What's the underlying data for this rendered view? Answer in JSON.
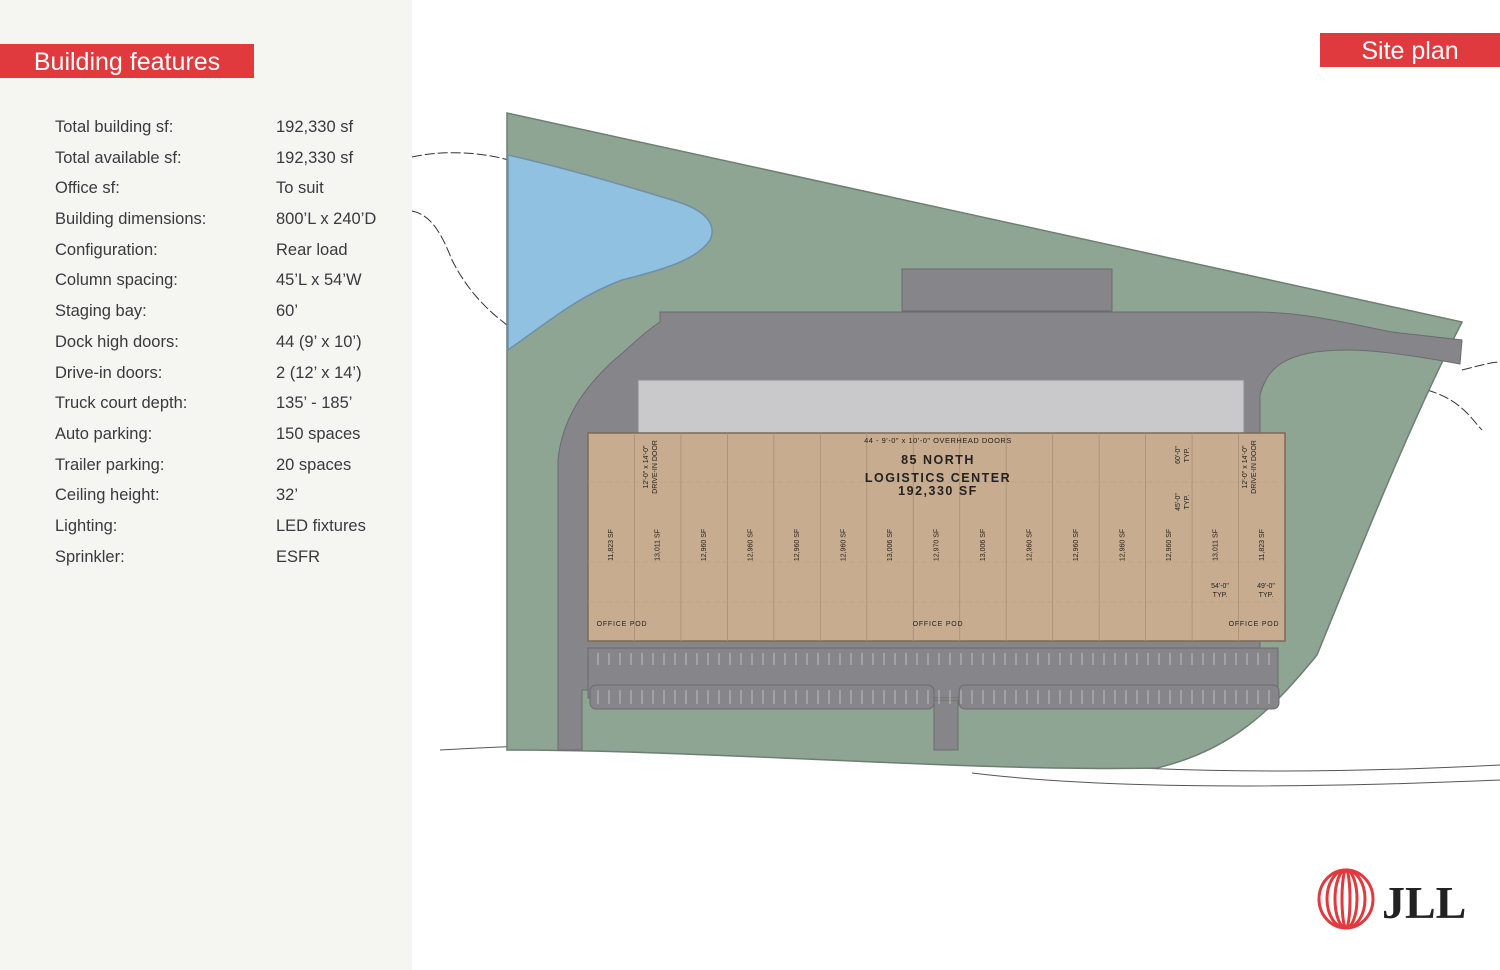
{
  "header": {
    "left_title": "Building features",
    "right_title": "Site plan"
  },
  "features": [
    {
      "label": "Total building sf:",
      "value": "192,330 sf"
    },
    {
      "label": "Total available sf:",
      "value": "192,330 sf"
    },
    {
      "label": "Office sf:",
      "value": "To suit"
    },
    {
      "label": "Building dimensions:",
      "value": "800’L x 240’D"
    },
    {
      "label": "Configuration:",
      "value": "Rear load"
    },
    {
      "label": "Column spacing:",
      "value": "45’L x 54’W"
    },
    {
      "label": "Staging bay:",
      "value": "60’"
    },
    {
      "label": "Dock  high doors:",
      "value": "44 (9’ x 10’)"
    },
    {
      "label": "Drive-in doors:",
      "value": "2 (12’ x 14’)"
    },
    {
      "label": "Truck court depth:",
      "value": "135’ - 185’"
    },
    {
      "label": "Auto parking:",
      "value": "150 spaces"
    },
    {
      "label": "Trailer parking:",
      "value": "20 spaces"
    },
    {
      "label": "Ceiling height:",
      "value": "32’"
    },
    {
      "label": "Lighting:",
      "value": "LED fixtures"
    },
    {
      "label": "Sprinkler:",
      "value": "ESFR"
    }
  ],
  "site_plan": {
    "building_name_line1": "85 NORTH",
    "building_name_line2": "LOGISTICS CENTER",
    "building_area": "192,330 SF",
    "overhead_doors_note": "44 - 9'-0\" x 10'-0\" OVERHEAD DOORS",
    "drive_in_size": "12'-0\" x 14'-0\"",
    "drive_in_label": "DRIVE-IN DOOR",
    "dim_60": "60'-0\"",
    "dim_45": "45'-0\"",
    "dim_54": "54'-0\"",
    "dim_49": "49'-0\"",
    "typ": "TYP.",
    "office_pod": "OFFICE POD",
    "bays": [
      "11,823 SF",
      "13,011 SF",
      "12,960 SF",
      "12,960 SF",
      "12,960 SF",
      "12,960 SF",
      "13,006 SF",
      "12,970 SF",
      "13,006 SF",
      "12,960 SF",
      "12,960 SF",
      "12,960 SF",
      "12,960 SF",
      "13,011 SF",
      "11,823 SF"
    ]
  },
  "logo": {
    "text": "JLL",
    "icon": "jll-logo-icon",
    "color": "#e03a3e"
  },
  "colors": {
    "accent": "#e03a3e",
    "grass": "#8fa594",
    "pond": "#91c1e0",
    "pavement": "#86868a",
    "building": "#c8ac8f"
  }
}
